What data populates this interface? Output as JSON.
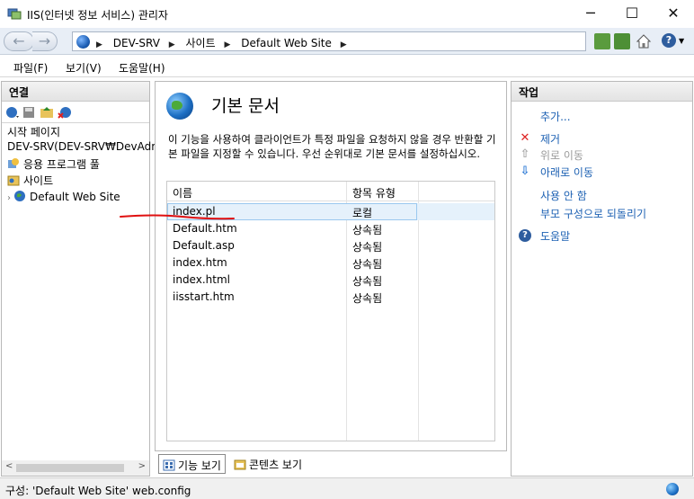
{
  "window": {
    "title": "IIS(인터넷 정보 서비스) 관리자",
    "controls": [
      "─",
      "☐",
      "✕"
    ]
  },
  "address": {
    "crumbs": [
      "DEV-SRV",
      "사이트",
      "Default Web Site"
    ],
    "separator": "▶"
  },
  "menu": {
    "items": [
      "파일(F)",
      "보기(V)",
      "도움말(H)"
    ]
  },
  "connections": {
    "header": "연결",
    "tree": [
      {
        "label": "시작 페이지",
        "icon": "start-page-icon"
      },
      {
        "label": "DEV-SRV(DEV-SRV₩DevAdm",
        "icon": "server-icon"
      },
      {
        "label": "응용 프로그램 풀",
        "icon": "app-pool-icon"
      },
      {
        "label": "사이트",
        "icon": "sites-folder-icon"
      },
      {
        "label": "Default Web Site",
        "icon": "website-globe-icon"
      }
    ],
    "scroll_left": "<",
    "scroll_right": ">"
  },
  "main": {
    "title": "기본 문서",
    "description": "이 기능을 사용하여 클라이언트가 특정 파일을 요청하지 않을 경우 반환할 기본 파일을 지정할 수 있습니다. 우선 순위대로 기본 문서를 설정하십시오.",
    "columns": [
      "이름",
      "항목 유형"
    ],
    "rows": [
      {
        "name": "index.pl",
        "type": "로컬",
        "selected": true
      },
      {
        "name": "Default.htm",
        "type": "상속됨"
      },
      {
        "name": "Default.asp",
        "type": "상속됨"
      },
      {
        "name": "index.htm",
        "type": "상속됨"
      },
      {
        "name": "index.html",
        "type": "상속됨"
      },
      {
        "name": "iisstart.htm",
        "type": "상속됨"
      }
    ],
    "tabs": [
      "기능 보기",
      "콘텐츠 보기"
    ]
  },
  "actions": {
    "header": "작업",
    "items": [
      {
        "label": "추가...",
        "enabled": true,
        "icon": ""
      },
      {
        "label": "제거",
        "enabled": true,
        "icon": "remove-x-icon"
      },
      {
        "label": "위로 이동",
        "enabled": false,
        "icon": "move-up-icon"
      },
      {
        "label": "아래로 이동",
        "enabled": true,
        "icon": "move-down-icon"
      },
      {
        "label": "사용 안 함",
        "enabled": true,
        "icon": ""
      },
      {
        "label": "부모 구성으로 되돌리기",
        "enabled": true,
        "icon": ""
      },
      {
        "label": "도움말",
        "enabled": true,
        "icon": "help-icon"
      }
    ]
  },
  "status": {
    "text": "구성: 'Default Web Site' web.config"
  },
  "colors": {
    "link": "#1d61b3",
    "disabled": "#9a9a9a",
    "selection": "#e5f1fb",
    "annotation": "#e01010"
  }
}
